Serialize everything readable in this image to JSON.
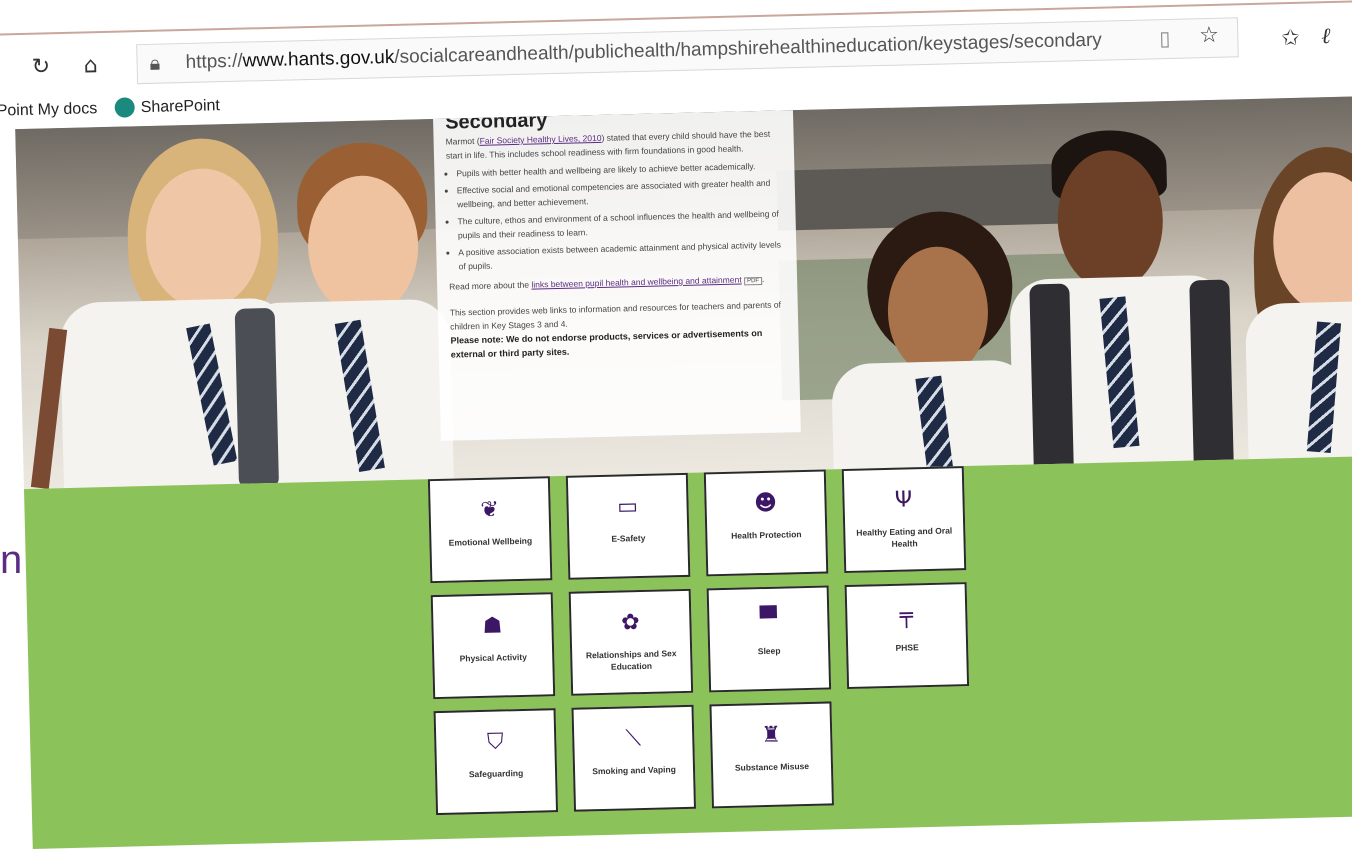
{
  "toolbar": {
    "refresh_icon": "refresh-icon",
    "home_icon": "home-icon",
    "url_prefix": "https://",
    "url_domain": "www.hants.gov.uk",
    "url_path": "/socialcareandhealth/publichealth/hampshirehealthineducation/keystages/secondary"
  },
  "favorites_bar": {
    "item_1": "Point My docs",
    "item_2": "SharePoint"
  },
  "info": {
    "title": "Secondary",
    "intro_pre": "Marmot (",
    "intro_link": "Fair Society Healthy Lives, 2010",
    "intro_post": ") stated that every child should have the best start in life. This includes school readiness with firm foundations in good health.",
    "bullets": [
      "Pupils with better health and wellbeing are likely to achieve better academically.",
      "Effective social and emotional competencies are associated with greater health and wellbeing, and better achievement.",
      "The culture, ethos and environment of a school influences the health and wellbeing of pupils and their readiness to learn.",
      "A positive association exists between academic attainment and physical activity levels of pupils."
    ],
    "read_more_pre": "Read more about the ",
    "read_more_link": "links between pupil health and wellbeing and attainment",
    "read_more_badge": "PDF",
    "section_text": "This section provides web links to information and resources for teachers and parents of children in Key Stages 3 and 4.",
    "note": "Please note: We do not endorse products, services or advertisements on external or third party sites."
  },
  "tiles": [
    {
      "label": "Emotional Wellbeing",
      "icon": "leaf-icon"
    },
    {
      "label": "E-Safety",
      "icon": "laptop-icon"
    },
    {
      "label": "Health Protection",
      "icon": "doctor-icon"
    },
    {
      "label": "Healthy Eating and Oral Health",
      "icon": "cutlery-icon"
    },
    {
      "label": "Physical Activity",
      "icon": "group-icon"
    },
    {
      "label": "Relationships and Sex Education",
      "icon": "flower-icon"
    },
    {
      "label": "Sleep",
      "icon": "bed-icon"
    },
    {
      "label": "PHSE",
      "icon": "signpost-icon"
    },
    {
      "label": "Safeguarding",
      "icon": "shield-icon"
    },
    {
      "label": "Smoking and Vaping",
      "icon": "cigarette-icon"
    },
    {
      "label": "Substance Misuse",
      "icon": "bottle-icon"
    }
  ],
  "edge_text": "n",
  "colors": {
    "accent_green": "#8cc25a",
    "brand_purple": "#3c1766",
    "link_purple": "#5a2d82"
  }
}
